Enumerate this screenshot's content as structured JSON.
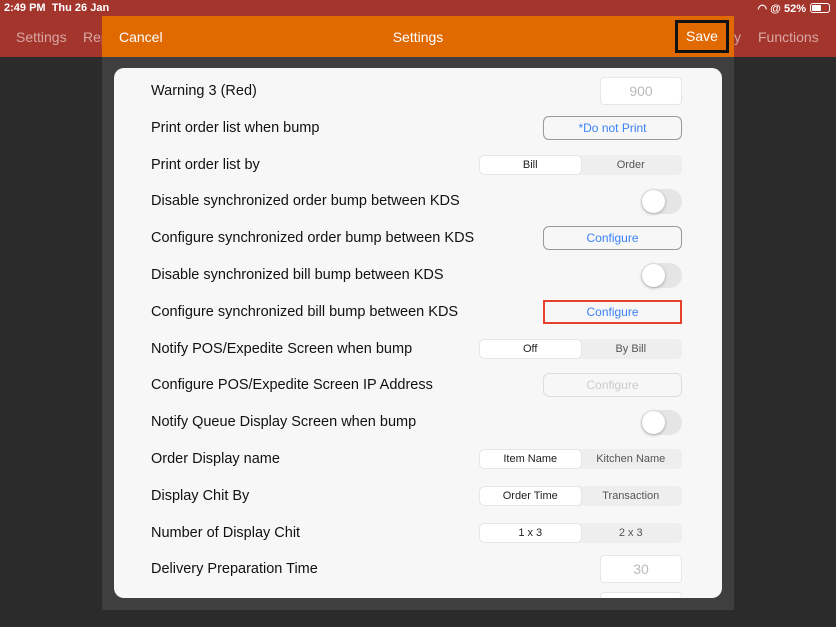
{
  "status": {
    "time": "2:49 PM",
    "date": "Thu 26 Jan",
    "battery": "52%",
    "battery_level": 0.52
  },
  "nav": {
    "items": [
      "Settings",
      "Rep",
      "y",
      "Functions"
    ]
  },
  "modal": {
    "cancel": "Cancel",
    "title": "Settings",
    "save": "Save"
  },
  "rows": [
    {
      "label": "Warning 3 (Red)",
      "type": "field",
      "value": "900"
    },
    {
      "label": "Print order list when bump",
      "type": "button",
      "value": "*Do not Print"
    },
    {
      "label": "Print order list by",
      "type": "segment",
      "options": [
        "Bill",
        "Order"
      ],
      "selected": 0
    },
    {
      "label": "Disable synchronized order bump between KDS",
      "type": "toggle",
      "on": false
    },
    {
      "label": "Configure synchronized order bump between KDS",
      "type": "button",
      "value": "Configure"
    },
    {
      "label": "Disable synchronized bill bump between KDS",
      "type": "toggle",
      "on": false
    },
    {
      "label": "Configure synchronized bill bump between KDS",
      "type": "button",
      "value": "Configure",
      "highlighted": true
    },
    {
      "label": "Notify POS/Expedite Screen when bump",
      "type": "segment",
      "options": [
        "Off",
        "By Bill"
      ],
      "selected": 0
    },
    {
      "label": "Configure POS/Expedite Screen IP Address",
      "type": "button",
      "value": "Configure",
      "disabled": true
    },
    {
      "label": "Notify Queue Display Screen when bump",
      "type": "toggle",
      "on": false
    },
    {
      "label": "Order Display name",
      "type": "segment",
      "options": [
        "Item Name",
        "Kitchen Name"
      ],
      "selected": 0
    },
    {
      "label": "Display Chit By",
      "type": "segment",
      "options": [
        "Order Time",
        "Transaction"
      ],
      "selected": 0
    },
    {
      "label": "Number of Display Chit",
      "type": "segment",
      "options": [
        "1 x 3",
        "2 x 3"
      ],
      "selected": 0
    },
    {
      "label": "Delivery Preparation Time",
      "type": "field",
      "value": "30"
    },
    {
      "label": "",
      "type": "field",
      "value": ""
    }
  ]
}
